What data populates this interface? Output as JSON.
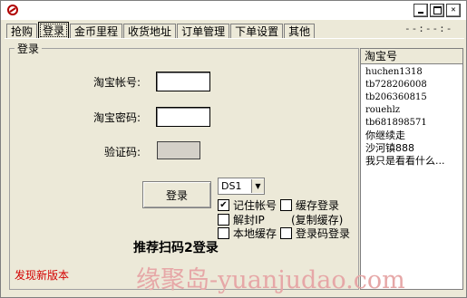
{
  "window": {
    "title": ""
  },
  "tabs": [
    "抢购",
    "登录",
    "金币里程",
    "收货地址",
    "订单管理",
    "下单设置",
    "其他"
  ],
  "timer": "--:--:--.-",
  "login": {
    "group_title": "登录",
    "account_label": "淘宝帐号:",
    "account_value": "",
    "password_label": "淘宝密码:",
    "password_value": "",
    "captcha_label": "验证码:",
    "login_button": "登录",
    "server_select": "DS1",
    "checkboxes": {
      "remember_account": {
        "label": "记住帐号",
        "checked": true
      },
      "save_cache": {
        "label": "缓存登录",
        "checked": false
      },
      "unseal_ip": {
        "label": "解封IP",
        "checked": false
      },
      "copy_cache": {
        "label": "(复制缓存)"
      },
      "local_cache": {
        "label": "本地缓存",
        "checked": false
      },
      "code_login": {
        "label": "登录码登录",
        "checked": false
      }
    },
    "promo": "推荐扫码2登录",
    "new_version": "发现新版本"
  },
  "accounts": {
    "header": "淘宝号",
    "items": [
      "huchen1318",
      "tb728206008",
      "tb206360815",
      "rouehlz",
      "tb681898571",
      "你继续走",
      "沙河镇888",
      "我只是看看什么..."
    ]
  },
  "watermark": "缘聚岛-yuanjudao.com"
}
